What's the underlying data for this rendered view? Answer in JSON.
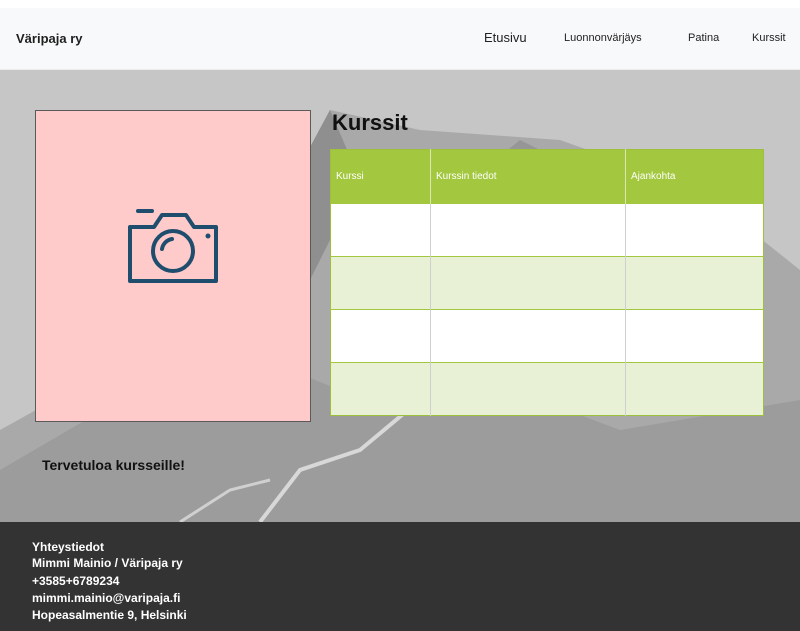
{
  "navbar": {
    "brand": "Väripaja ry",
    "links": [
      {
        "label": "Etusivu"
      },
      {
        "label": "Luonnonvärjäys"
      },
      {
        "label": "Patina"
      },
      {
        "label": "Kurssit"
      }
    ]
  },
  "hero": {
    "photo_icon": "camera-icon",
    "welcome_text": "Tervetuloa kursseille!"
  },
  "courses": {
    "title": "Kurssit",
    "columns": [
      "Kurssi",
      "Kurssin tiedot",
      "Ajankohta"
    ],
    "rows": [
      [
        "",
        "",
        ""
      ],
      [
        "",
        "",
        ""
      ],
      [
        "",
        "",
        ""
      ],
      [
        "",
        "",
        ""
      ]
    ]
  },
  "footer": {
    "heading": "Yhteystiedot",
    "name": "Mimmi Mainio / Väripaja ry",
    "phone": "+3585+6789234",
    "email": "mimmi.mainio@varipaja.fi",
    "address": "Hopeasalmentie 9, Helsinki"
  },
  "colors": {
    "table_header": "#a3c73e",
    "table_stripe": "#e8f0d6",
    "photo_placeholder": "#ffcaca",
    "camera": "#1f4d6e",
    "footer_bg": "#333333",
    "hero_bg": "#c9c9c9"
  }
}
